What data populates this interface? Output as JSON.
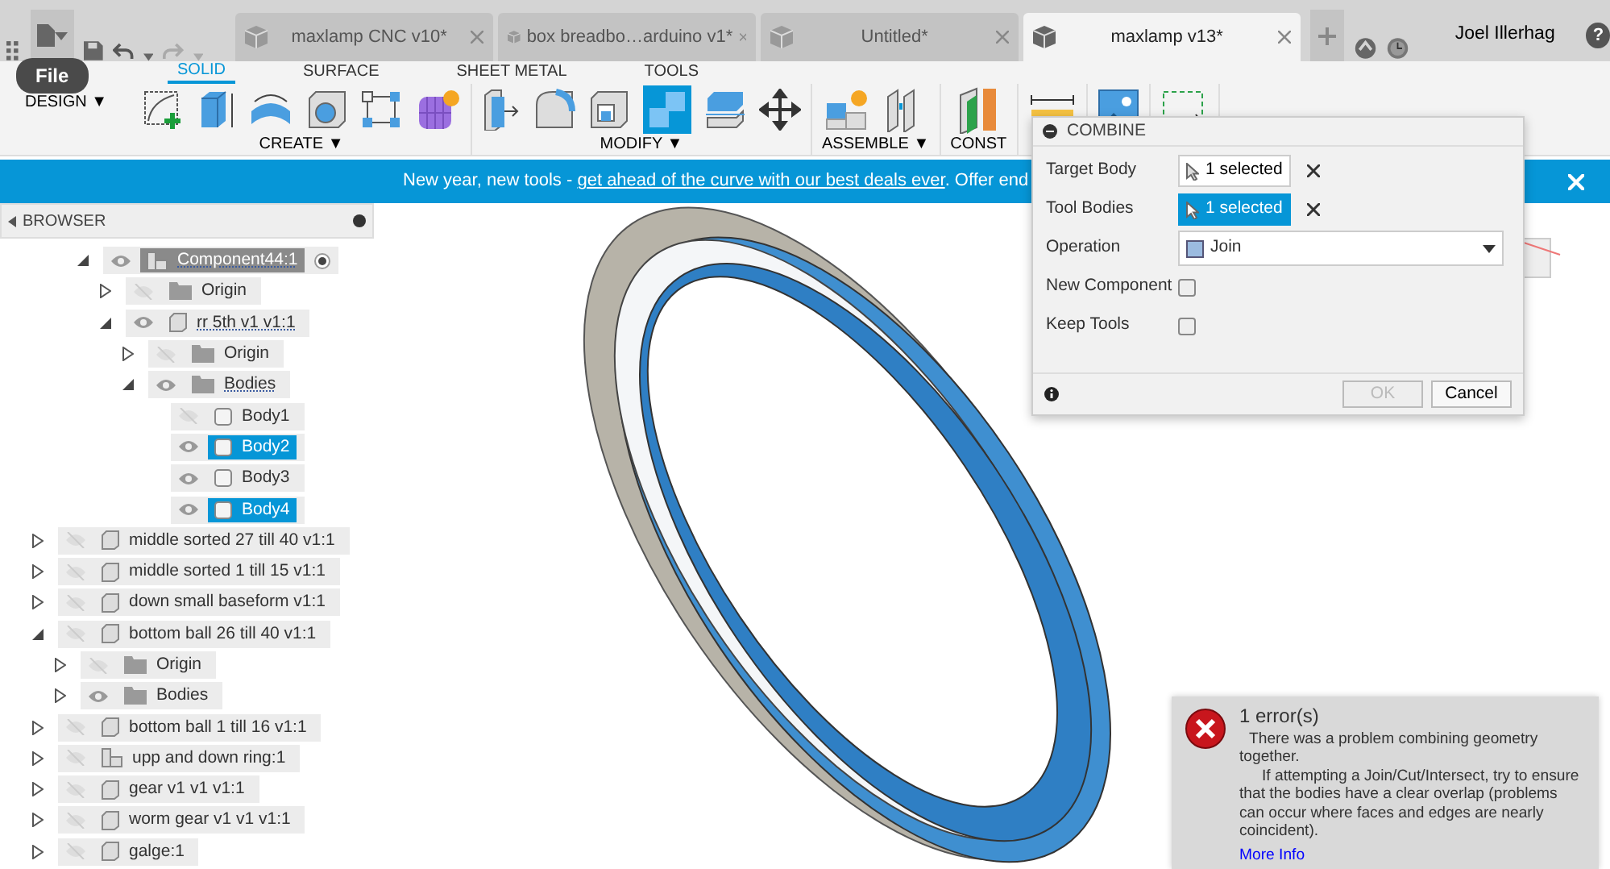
{
  "tabs": [
    {
      "label": "maxlamp CNC v10*",
      "selected": false
    },
    {
      "label": "box breadbo…arduino v1*",
      "selected": false
    },
    {
      "label": "Untitled*",
      "selected": false
    },
    {
      "label": "maxlamp v13*",
      "selected": true
    }
  ],
  "user": "Joel Illerhag",
  "help": "?",
  "file_tooltip": "File",
  "workspace": "DESIGN ▼",
  "toolbar_tabs": [
    {
      "label": "SOLID",
      "selected": true
    },
    {
      "label": "SURFACE",
      "selected": false
    },
    {
      "label": "SHEET METAL",
      "selected": false
    },
    {
      "label": "TOOLS",
      "selected": false
    }
  ],
  "toolbar_groups": [
    {
      "kind": "create",
      "label": "CREATE ▼"
    },
    {
      "kind": "modify",
      "label": "MODIFY ▼"
    },
    {
      "kind": "assemble",
      "label": "ASSEMBLE ▼"
    },
    {
      "kind": "construct",
      "label": "CONST"
    },
    {
      "kind": "inspect"
    },
    {
      "kind": "insert"
    },
    {
      "kind": "select"
    }
  ],
  "banner": {
    "text": "New year, new tools - ",
    "link": "get ahead of the curve with our best deals ever",
    "tail": ". Offer end"
  },
  "browser": {
    "title": "BROWSER",
    "continued_items": [
      {
        "label": "Component44:1",
        "kind": "component",
        "visible": true,
        "expanded": true,
        "active": true,
        "dotted_underline": true,
        "selected": false,
        "children": [
          {
            "label": "Origin",
            "kind": "folder",
            "visible": false,
            "expanded": false,
            "selected": false
          },
          {
            "label": "rr 5th v1 v1:1",
            "kind": "body-component",
            "visible": true,
            "expanded": true,
            "dotted_underline": true,
            "selected": false,
            "children": [
              {
                "label": "Origin",
                "kind": "folder",
                "visible": false,
                "expanded": false,
                "selected": false
              },
              {
                "label": "Bodies",
                "kind": "folder",
                "visible": true,
                "expanded": true,
                "dotted_underline": true,
                "selected": false,
                "children": [
                  {
                    "label": "Body1",
                    "kind": "body",
                    "visible": false,
                    "selected": false
                  },
                  {
                    "label": "Body2",
                    "kind": "body",
                    "visible": true,
                    "selected": true
                  },
                  {
                    "label": "Body3",
                    "kind": "body",
                    "visible": true,
                    "selected": false
                  },
                  {
                    "label": "Body4",
                    "kind": "body",
                    "visible": true,
                    "selected": true
                  }
                ]
              }
            ]
          }
        ]
      }
    ],
    "items": [
      {
        "label": "middle sorted 27 till 40 v1:1",
        "kind": "body-component",
        "visible": false,
        "expanded": false,
        "selected": false
      },
      {
        "label": "middle sorted 1 till 15 v1:1",
        "kind": "body-component",
        "visible": false,
        "expanded": false,
        "selected": false
      },
      {
        "label": "down small baseform v1:1",
        "kind": "body-component",
        "visible": false,
        "expanded": false,
        "selected": false
      },
      {
        "label": "bottom ball 26 till 40 v1:1",
        "kind": "body-component",
        "visible": false,
        "expanded": true,
        "selected": false,
        "children": [
          {
            "label": "Origin",
            "kind": "folder",
            "visible": false,
            "expanded": false,
            "selected": false
          },
          {
            "label": "Bodies",
            "kind": "folder",
            "visible": true,
            "expanded": false,
            "selected": false
          }
        ]
      },
      {
        "label": "bottom ball 1 till 16 v1:1",
        "kind": "body-component",
        "visible": false,
        "expanded": false,
        "selected": false
      },
      {
        "label": "upp and down ring:1",
        "kind": "component",
        "visible": false,
        "expanded": false,
        "selected": false
      },
      {
        "label": "gear v1 v1 v1:1",
        "kind": "body-component",
        "visible": false,
        "expanded": false,
        "selected": false
      },
      {
        "label": "worm gear v1 v1 v1:1",
        "kind": "body-component",
        "visible": false,
        "expanded": false,
        "selected": false
      },
      {
        "label": "galge:1",
        "kind": "body-component",
        "visible": false,
        "expanded": false,
        "selected": false
      }
    ]
  },
  "dialog": {
    "title": "COMBINE",
    "rows": [
      {
        "kind": "selection",
        "label": "Target Body",
        "value": "1 selected",
        "selected": false
      },
      {
        "kind": "selection",
        "label": "Tool Bodies",
        "value": "1 selected",
        "selected": true
      },
      {
        "kind": "dropdown",
        "label": "Operation",
        "value": "Join"
      },
      {
        "kind": "checkbox",
        "label": "New Component",
        "checked": false
      },
      {
        "kind": "checkbox",
        "label": "Keep Tools",
        "checked": false
      }
    ],
    "ok": {
      "label": "OK",
      "disabled": true
    },
    "cancel": {
      "label": "Cancel"
    }
  },
  "error": {
    "title": "1 error(s)",
    "message": "There was a problem combining geometry together.",
    "detail": "If attempting a Join/Cut/Intersect, try to ensure that the bodies have a clear overlap (problems can occur where faces and edges are nearly coincident).",
    "link": "More Info"
  }
}
